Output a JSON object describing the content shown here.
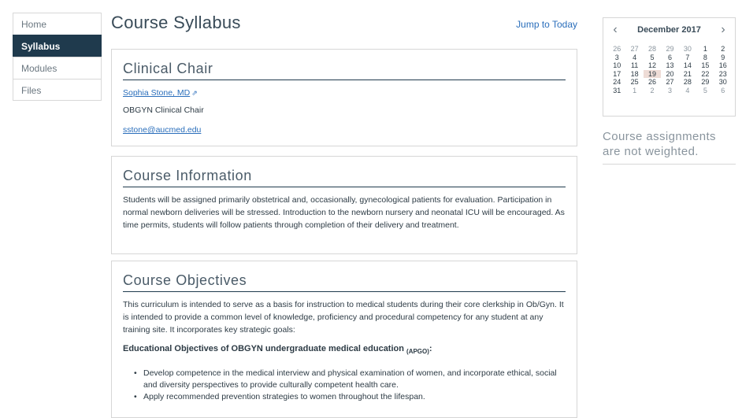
{
  "nav": {
    "items": [
      {
        "label": "Home"
      },
      {
        "label": "Syllabus"
      },
      {
        "label": "Modules"
      },
      {
        "label": "Files"
      }
    ]
  },
  "page": {
    "title": "Course Syllabus",
    "jump_label": "Jump to Today"
  },
  "clinical_chair": {
    "heading": "Clinical Chair",
    "name": "Sophia Stone, MD",
    "role": "OBGYN Clinical Chair",
    "email": "sstone@aucmed.edu"
  },
  "course_information": {
    "heading": "Course Information",
    "body": "Students will be assigned primarily obstetrical and, occasionally, gynecological patients for evaluation. Participation in normal newborn deliveries will be stressed. Introduction to the newborn nursery and neonatal ICU will be encouraged. As time permits, students will follow patients through completion of their delivery and treatment."
  },
  "course_objectives": {
    "heading": "Course Objectives",
    "intro": "This curriculum is intended to serve as a basis for instruction to medical students during their core clerkship in Ob/Gyn. It is intended to provide a common level of knowledge, proficiency and procedural competency for any student at any training site. It incorporates key strategic goals:",
    "subheading": "Educational Objectives of OBGYN undergraduate medical education",
    "subheading_sub": "(APGO)",
    "subheading_colon": ":",
    "bullets": [
      "Develop competence in the medical interview and physical examination of women, and incorporate ethical, social and diversity perspectives to provide culturally competent health care.",
      "Apply recommended prevention strategies to women throughout the lifespan."
    ]
  },
  "calendar": {
    "month_label": "December 2017",
    "prev_symbol": "‹",
    "next_symbol": "›",
    "weeks": [
      [
        "26",
        "27",
        "28",
        "29",
        "30",
        "1",
        "2"
      ],
      [
        "3",
        "4",
        "5",
        "6",
        "7",
        "8",
        "9"
      ],
      [
        "10",
        "11",
        "12",
        "13",
        "14",
        "15",
        "16"
      ],
      [
        "17",
        "18",
        "19",
        "20",
        "21",
        "22",
        "23"
      ],
      [
        "24",
        "25",
        "26",
        "27",
        "28",
        "29",
        "30"
      ],
      [
        "31",
        "1",
        "2",
        "3",
        "4",
        "5",
        "6"
      ]
    ],
    "today": "19"
  },
  "sidebar": {
    "weight_note": "Course assignments are not weighted."
  }
}
